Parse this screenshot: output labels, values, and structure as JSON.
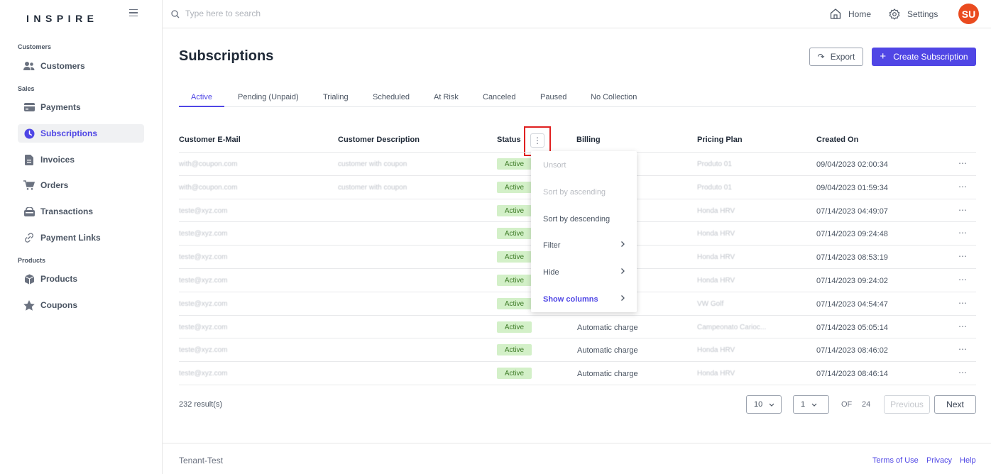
{
  "app": {
    "logo": "INSPIRE"
  },
  "sidebar": {
    "sections": [
      {
        "label": "Customers"
      },
      {
        "label": "Sales"
      },
      {
        "label": "Products"
      }
    ],
    "items": [
      {
        "label": "Customers",
        "icon": "users-icon"
      },
      {
        "label": "Payments",
        "icon": "credit-card-icon"
      },
      {
        "label": "Subscriptions",
        "icon": "clock-icon",
        "active": true
      },
      {
        "label": "Invoices",
        "icon": "document-icon"
      },
      {
        "label": "Orders",
        "icon": "cart-icon"
      },
      {
        "label": "Transactions",
        "icon": "wallet-icon"
      },
      {
        "label": "Payment Links",
        "icon": "link-icon"
      },
      {
        "label": "Products",
        "icon": "box-icon"
      },
      {
        "label": "Coupons",
        "icon": "star-icon"
      }
    ]
  },
  "topbar": {
    "search_placeholder": "Type here to search",
    "home_label": "Home",
    "settings_label": "Settings",
    "avatar_initials": "SU"
  },
  "page": {
    "title": "Subscriptions",
    "export_label": "Export",
    "create_label": "Create Subscription"
  },
  "tabs": [
    "Active",
    "Pending (Unpaid)",
    "Trialing",
    "Scheduled",
    "At Risk",
    "Canceled",
    "Paused",
    "No Collection"
  ],
  "table": {
    "columns": [
      "Customer E-Mail",
      "Customer Description",
      "Status",
      "Billing",
      "Pricing Plan",
      "Created On"
    ],
    "rows": [
      {
        "email": "with@coupon.com",
        "description": "customer with coupon",
        "status": "Active",
        "billing": "",
        "plan": "Produto 01",
        "created": "09/04/2023 02:00:34"
      },
      {
        "email": "with@coupon.com",
        "description": "customer with coupon",
        "status": "Active",
        "billing": "",
        "plan": "Produto 01",
        "created": "09/04/2023 01:59:34"
      },
      {
        "email": "teste@xyz.com",
        "description": "",
        "status": "Active",
        "billing": "",
        "plan": "Honda HRV",
        "created": "07/14/2023 04:49:07"
      },
      {
        "email": "teste@xyz.com",
        "description": "",
        "status": "Active",
        "billing": "",
        "plan": "Honda HRV",
        "created": "07/14/2023 09:24:48"
      },
      {
        "email": "teste@xyz.com",
        "description": "",
        "status": "Active",
        "billing": "",
        "plan": "Honda HRV",
        "created": "07/14/2023 08:53:19"
      },
      {
        "email": "teste@xyz.com",
        "description": "",
        "status": "Active",
        "billing": "",
        "plan": "Honda HRV",
        "created": "07/14/2023 09:24:02"
      },
      {
        "email": "teste@xyz.com",
        "description": "",
        "status": "Active",
        "billing": "",
        "plan": "VW Golf",
        "created": "07/14/2023 04:54:47"
      },
      {
        "email": "teste@xyz.com",
        "description": "",
        "status": "Active",
        "billing": "Automatic charge",
        "plan": "Campeonato Carioc...",
        "created": "07/14/2023 05:05:14"
      },
      {
        "email": "teste@xyz.com",
        "description": "",
        "status": "Active",
        "billing": "Automatic charge",
        "plan": "Honda HRV",
        "created": "07/14/2023 08:46:02"
      },
      {
        "email": "teste@xyz.com",
        "description": "",
        "status": "Active",
        "billing": "Automatic charge",
        "plan": "Honda HRV",
        "created": "07/14/2023 08:46:14"
      }
    ]
  },
  "column_menu": {
    "items": [
      "Unsort",
      "Sort by ascending",
      "Sort by descending",
      "Filter",
      "Hide",
      "Show columns"
    ]
  },
  "pagination": {
    "results": "232 result(s)",
    "page_size": "10",
    "current_page": "1",
    "of_label": "OF",
    "total_pages": "24",
    "previous_label": "Previous",
    "next_label": "Next"
  },
  "footer": {
    "tenant": "Tenant-Test",
    "terms": "Terms of Use",
    "privacy": "Privacy",
    "help": "Help"
  },
  "colors": {
    "accent": "#5046e5",
    "active_badge_bg": "#d3f0c8",
    "active_badge_text": "#3e7b27",
    "avatar": "#ea4b1f",
    "highlight_border": "#e02020"
  }
}
